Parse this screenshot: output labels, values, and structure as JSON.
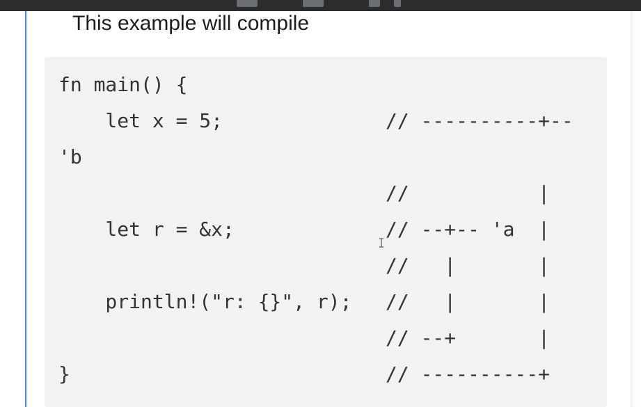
{
  "heading": "This example will compile",
  "code": {
    "lines": [
      "fn main() {",
      "    let x = 5;",
      "'b",
      "",
      "    let r = &x;",
      "",
      "    println!(\"r: {}\", r);",
      "",
      "}"
    ],
    "comments": [
      "",
      "// ----------+--",
      "",
      "//           |",
      "// --+-- 'a  |",
      "//   |       |",
      "//   |       |",
      "// --+       |",
      "// ----------+"
    ]
  },
  "icons": {
    "cursor": "text-cursor-icon"
  }
}
